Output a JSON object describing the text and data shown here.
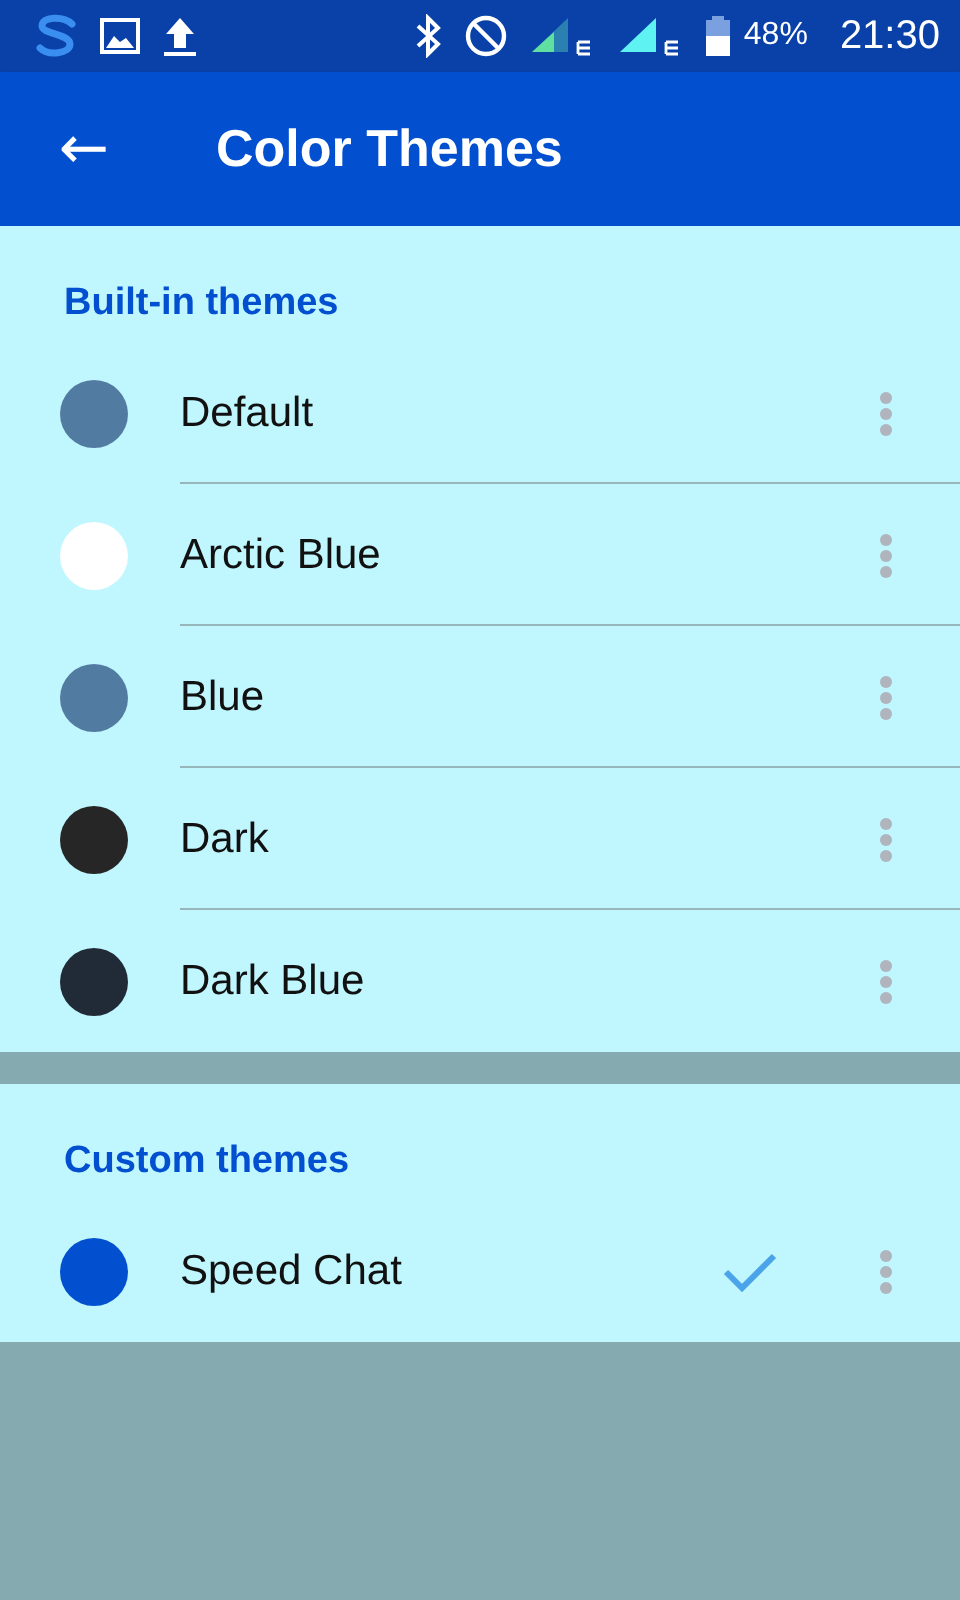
{
  "status_bar": {
    "battery": "48%",
    "time": "21:30"
  },
  "app_bar": {
    "back": "←",
    "title": "Color Themes"
  },
  "sections": [
    {
      "title": "Built-in themes",
      "themes": [
        {
          "name": "Default",
          "color": "#527ba1",
          "selected": false
        },
        {
          "name": "Arctic Blue",
          "color": "#ffffff",
          "selected": false
        },
        {
          "name": "Blue",
          "color": "#527ba1",
          "selected": false
        },
        {
          "name": "Dark",
          "color": "#262626",
          "selected": false
        },
        {
          "name": "Dark Blue",
          "color": "#212a37",
          "selected": false
        }
      ]
    },
    {
      "title": "Custom themes",
      "themes": [
        {
          "name": "Speed Chat",
          "color": "#0250d0",
          "selected": true
        }
      ]
    }
  ]
}
